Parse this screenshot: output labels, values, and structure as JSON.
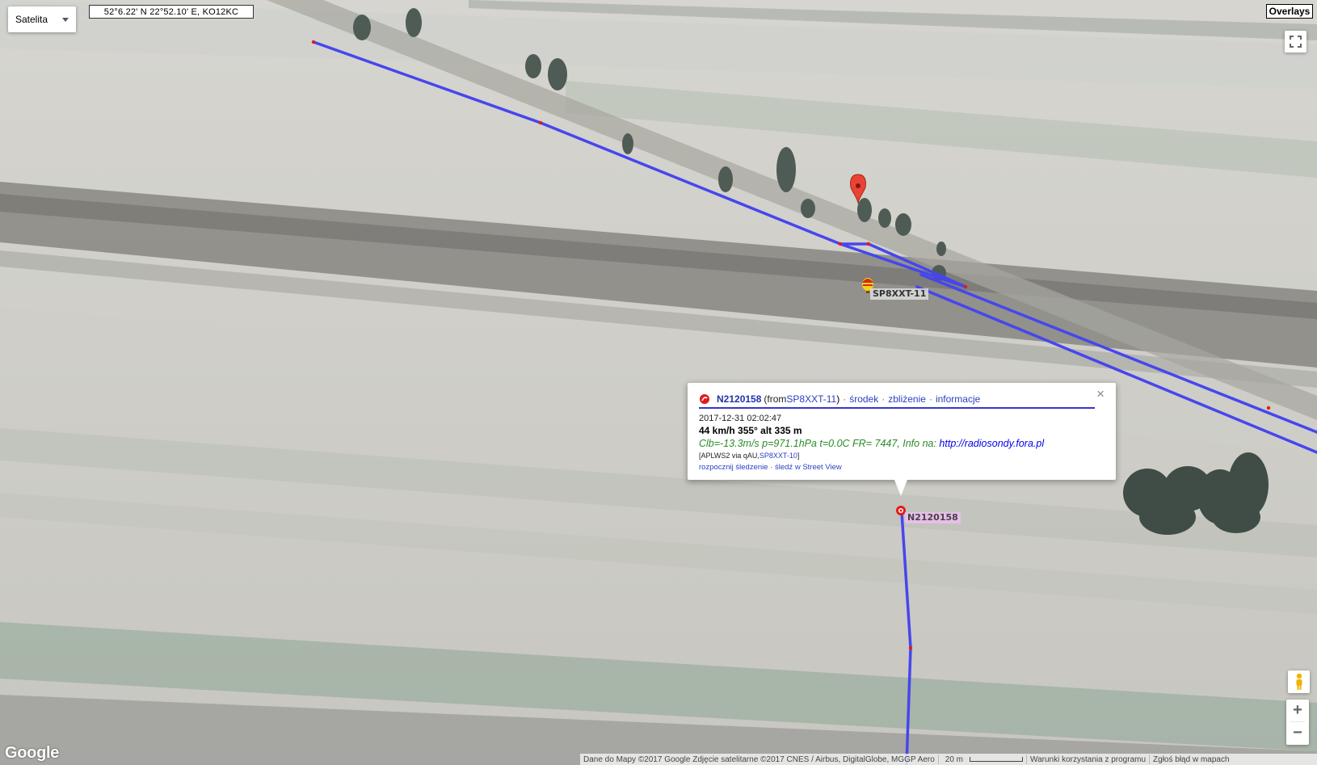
{
  "map": {
    "map_type_label": "Satelita",
    "coords_readout": "52°6.22' N 22°52.10' E, KO12KC",
    "overlays_label": "Overlays",
    "logo_text": "Google",
    "watermark_text": "© 2017 Google",
    "attribution": "Dane do Mapy ©2017 Google Zdjęcie satelitarne ©2017 CNES / Airbus, DigitalGlobe, MGGP Aero",
    "scale_label": "20 m",
    "terms_label": "Warunki korzystania z programu",
    "report_label": "Zgłoś błąd w mapach",
    "track_color": "#4646ee",
    "track_point_color": "#e21a1a"
  },
  "markers": {
    "station_label": "SP8XXT-11",
    "balloon_label": "N2120158"
  },
  "popup": {
    "callsign": "N2120158",
    "from_prefix": "(from ",
    "from_call": "SP8XXT-11",
    "from_suffix": ")",
    "links": [
      "środek",
      "zbliżenie",
      "informacje"
    ],
    "timestamp": "2017-12-31 02:02:47",
    "speed_alt": "44 km/h 355° alt 335 m",
    "comment_text": "Clb=-13.3m/s p=971.1hPa t=0.0C FR= 7447, Info na: ",
    "comment_url": "http://radiosondy.fora.pl",
    "path_prefix": "[APLWS2 via qAU,",
    "path_call": "SP8XXT-10",
    "path_suffix": "]",
    "action_track": "rozpocznij śledzenie",
    "action_streetview": "śledź w Street View",
    "close_symbol": "×",
    "separator": "·"
  },
  "controls": {
    "zoom_in": "+",
    "zoom_out": "−"
  }
}
